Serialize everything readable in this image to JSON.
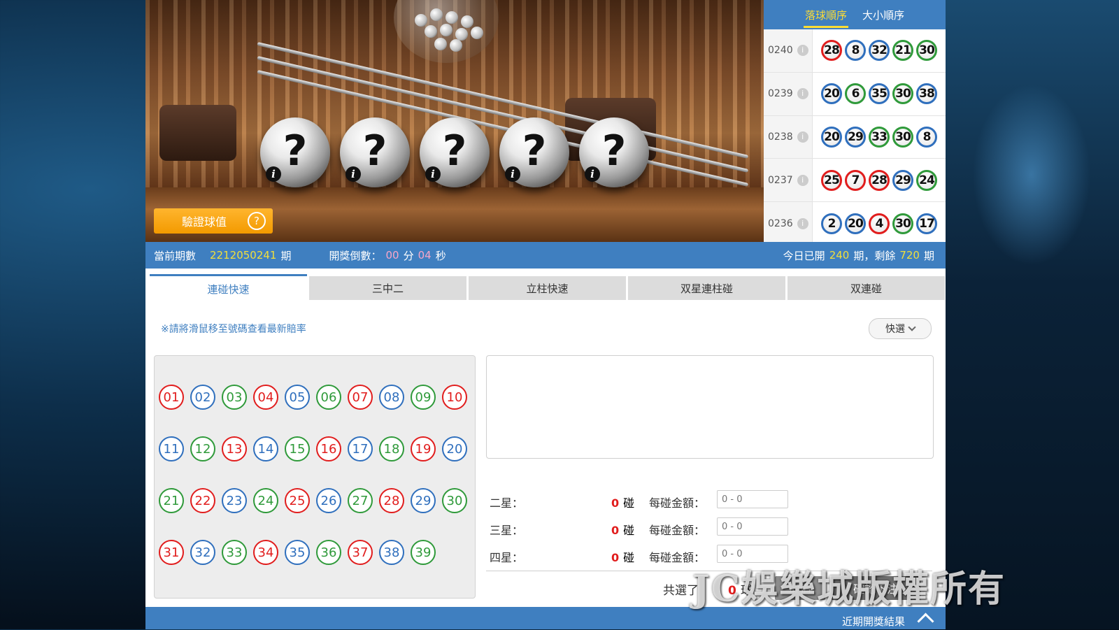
{
  "stage": {
    "draw_mark": "?",
    "info_mark": "i",
    "verify_label": "驗證球值",
    "verify_help": "?"
  },
  "history": {
    "tabs": [
      {
        "label": "落球順序",
        "active": true
      },
      {
        "label": "大小順序",
        "active": false
      }
    ],
    "rows": [
      {
        "period": "0240",
        "balls": [
          {
            "n": "28",
            "c": "red"
          },
          {
            "n": "8",
            "c": "blue"
          },
          {
            "n": "32",
            "c": "blue"
          },
          {
            "n": "21",
            "c": "green"
          },
          {
            "n": "30",
            "c": "green"
          }
        ]
      },
      {
        "period": "0239",
        "balls": [
          {
            "n": "20",
            "c": "blue"
          },
          {
            "n": "6",
            "c": "green"
          },
          {
            "n": "35",
            "c": "blue"
          },
          {
            "n": "30",
            "c": "green"
          },
          {
            "n": "38",
            "c": "blue"
          }
        ]
      },
      {
        "period": "0238",
        "balls": [
          {
            "n": "20",
            "c": "blue"
          },
          {
            "n": "29",
            "c": "blue"
          },
          {
            "n": "33",
            "c": "green"
          },
          {
            "n": "30",
            "c": "green"
          },
          {
            "n": "8",
            "c": "blue"
          }
        ]
      },
      {
        "period": "0237",
        "balls": [
          {
            "n": "25",
            "c": "red"
          },
          {
            "n": "7",
            "c": "red"
          },
          {
            "n": "28",
            "c": "red"
          },
          {
            "n": "29",
            "c": "blue"
          },
          {
            "n": "24",
            "c": "green"
          }
        ]
      },
      {
        "period": "0236",
        "balls": [
          {
            "n": "2",
            "c": "blue"
          },
          {
            "n": "20",
            "c": "blue"
          },
          {
            "n": "4",
            "c": "red"
          },
          {
            "n": "30",
            "c": "green"
          },
          {
            "n": "17",
            "c": "blue"
          }
        ]
      }
    ]
  },
  "info_bar": {
    "current_label": "當前期數",
    "current_value": "2212050241",
    "period_unit": "期",
    "countdown_label": "開獎倒數：",
    "minutes": "00",
    "min_unit": "分",
    "seconds": "04",
    "sec_unit": "秒",
    "today_label": "今日已開",
    "today_value": "240",
    "remain_label": "期，剩餘",
    "remain_value": "720",
    "remain_unit": "期"
  },
  "tabs": [
    {
      "label": "連碰快速",
      "active": true
    },
    {
      "label": "三中二",
      "active": false
    },
    {
      "label": "立柱快速",
      "active": false
    },
    {
      "label": "双星連柱碰",
      "active": false
    },
    {
      "label": "双連碰",
      "active": false
    }
  ],
  "hint": "※請將滑鼠移至號碼查看最新賠率",
  "quick_label": "快選",
  "numbers": [
    {
      "n": "01",
      "c": "red"
    },
    {
      "n": "02",
      "c": "blue"
    },
    {
      "n": "03",
      "c": "green"
    },
    {
      "n": "04",
      "c": "red"
    },
    {
      "n": "05",
      "c": "blue"
    },
    {
      "n": "06",
      "c": "green"
    },
    {
      "n": "07",
      "c": "red"
    },
    {
      "n": "08",
      "c": "blue"
    },
    {
      "n": "09",
      "c": "green"
    },
    {
      "n": "10",
      "c": "red"
    },
    {
      "n": "11",
      "c": "blue"
    },
    {
      "n": "12",
      "c": "green"
    },
    {
      "n": "13",
      "c": "red"
    },
    {
      "n": "14",
      "c": "blue"
    },
    {
      "n": "15",
      "c": "green"
    },
    {
      "n": "16",
      "c": "red"
    },
    {
      "n": "17",
      "c": "blue"
    },
    {
      "n": "18",
      "c": "green"
    },
    {
      "n": "19",
      "c": "red"
    },
    {
      "n": "20",
      "c": "blue"
    },
    {
      "n": "21",
      "c": "green"
    },
    {
      "n": "22",
      "c": "red"
    },
    {
      "n": "23",
      "c": "blue"
    },
    {
      "n": "24",
      "c": "green"
    },
    {
      "n": "25",
      "c": "red"
    },
    {
      "n": "26",
      "c": "blue"
    },
    {
      "n": "27",
      "c": "green"
    },
    {
      "n": "28",
      "c": "red"
    },
    {
      "n": "29",
      "c": "blue"
    },
    {
      "n": "30",
      "c": "green"
    },
    {
      "n": "31",
      "c": "red"
    },
    {
      "n": "32",
      "c": "blue"
    },
    {
      "n": "33",
      "c": "green"
    },
    {
      "n": "34",
      "c": "red"
    },
    {
      "n": "35",
      "c": "blue"
    },
    {
      "n": "36",
      "c": "green"
    },
    {
      "n": "37",
      "c": "red"
    },
    {
      "n": "38",
      "c": "blue"
    },
    {
      "n": "39",
      "c": "green"
    }
  ],
  "bets": [
    {
      "label": "二星：",
      "count": "0",
      "count_unit": "碰",
      "amount_label": "每碰金額：",
      "placeholder": "0 - 0"
    },
    {
      "label": "三星：",
      "count": "0",
      "count_unit": "碰",
      "amount_label": "每碰金額：",
      "placeholder": "0 - 0"
    },
    {
      "label": "四星：",
      "count": "0",
      "count_unit": "碰",
      "amount_label": "每碰金額：",
      "placeholder": "0 - 0"
    }
  ],
  "total": {
    "label": "共選了",
    "value": "0",
    "unit": "球"
  },
  "buttons": {
    "cancel": "取消",
    "confirm": "確認下注"
  },
  "watermark": "JC娛樂城版權所有",
  "bottom": {
    "label": "近期開獎結果"
  },
  "colors": {
    "red": "#e11d1d",
    "blue": "#2f6fbd",
    "green": "#2f9a3a",
    "accent": "#3f7fc0",
    "orange": "#f39a00"
  }
}
